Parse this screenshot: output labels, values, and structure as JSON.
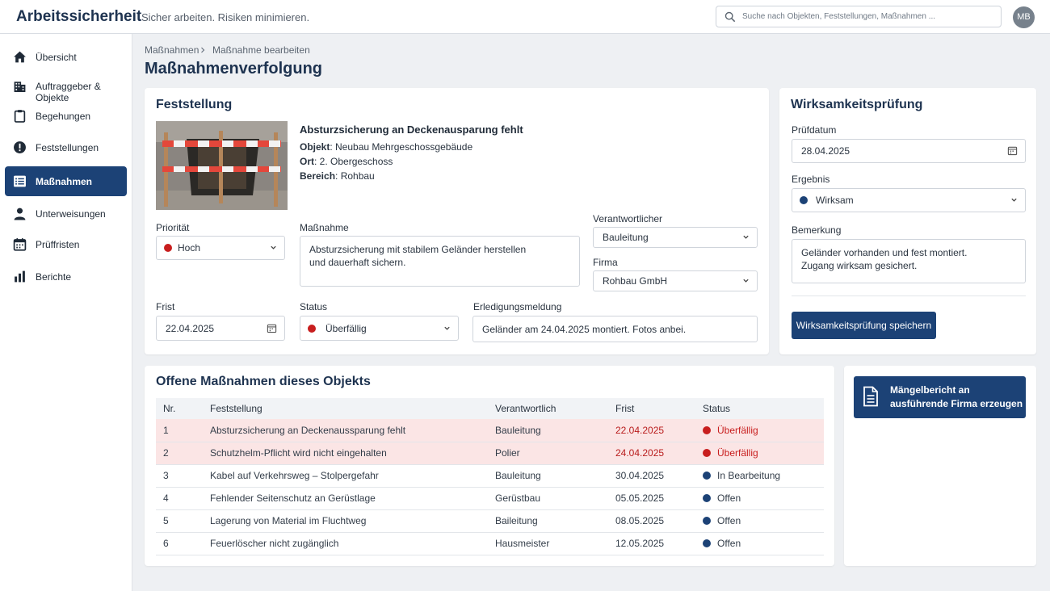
{
  "header": {
    "brand": "Arbeitssicherheit",
    "tagline": "Sicher arbeiten. Risiken minimieren.",
    "search_placeholder": "Suche nach Objekten, Feststellungen, Maßnahmen ...",
    "avatar": "MB"
  },
  "sidebar": {
    "items": [
      {
        "label": "Übersicht",
        "icon": "home-icon"
      },
      {
        "label": "Auftraggeber & Objekte",
        "icon": "building-icon"
      },
      {
        "label": "Begehungen",
        "icon": "clipboard-icon"
      },
      {
        "label": "Feststellungen",
        "icon": "alert-icon"
      },
      {
        "label": "Maßnahmen",
        "icon": "list-icon",
        "active": true
      },
      {
        "label": "Unterweisungen",
        "icon": "person-icon"
      },
      {
        "label": "Prüffristen",
        "icon": "calendar-icon"
      },
      {
        "label": "Berichte",
        "icon": "bar-chart-icon"
      }
    ]
  },
  "breadcrumb": {
    "parent": "Maßnahmen",
    "current": "Maßnahme bearbeiten"
  },
  "page_title": "Maßnahmenverfolgung",
  "feststellung": {
    "title": "Feststellung",
    "heading": "Absturzsicherung an Deckenausparung fehlt",
    "objekt_label": "Objekt",
    "objekt": ": Neubau Mehrgeschossgebäude",
    "ort_label": "Ort",
    "ort": ": 2. Obergeschoss",
    "bereich_label": "Bereich",
    "bereich": ": Rohbau",
    "prioritaet_label": "Priorität",
    "prioritaet": "Hoch",
    "massnahme_label": "Maßnahme",
    "massnahme": "Absturzsicherung mit stabilem Geländer herstellen\nund dauerhaft sichern.",
    "verantwortlicher_label": "Verantwortlicher",
    "verantwortlicher": "Bauleitung",
    "firma_label": "Firma",
    "firma": "Rohbau GmbH",
    "frist_label": "Frist",
    "frist": "22.04.2025",
    "status_label": "Status",
    "status": "Überfällig",
    "erledigung_label": "Erledigungsmeldung",
    "erledigung": "Geländer am 24.04.2025 montiert. Fotos anbei."
  },
  "wirksamkeit": {
    "title": "Wirksamkeitsprüfung",
    "pruefdatum_label": "Prüfdatum",
    "pruefdatum": "28.04.2025",
    "ergebnis_label": "Ergebnis",
    "ergebnis": "Wirksam",
    "bemerkung_label": "Bemerkung",
    "bemerkung": "Geländer vorhanden und fest montiert.\nZugang wirksam gesichert.",
    "save_label": "Wirksamkeitsprüfung speichern"
  },
  "offene": {
    "title": "Offene Maßnahmen dieses Objekts",
    "columns": [
      "Nr.",
      "Feststellung",
      "Verantwortlich",
      "Frist",
      "Status"
    ],
    "rows": [
      {
        "nr": "1",
        "feststellung": "Absturzsicherung an Deckenaussparung fehlt",
        "verantwortlich": "Bauleitung",
        "frist": "22.04.2025",
        "status": "Überfällig",
        "overdue": true
      },
      {
        "nr": "2",
        "feststellung": "Schutzhelm-Pflicht wird nicht eingehalten",
        "verantwortlich": "Polier",
        "frist": "24.04.2025",
        "status": "Überfällig",
        "overdue": true
      },
      {
        "nr": "3",
        "feststellung": "Kabel auf Verkehrsweg – Stolpergefahr",
        "verantwortlich": "Bauleitung",
        "frist": "30.04.2025",
        "status": "In Bearbeitung",
        "overdue": false
      },
      {
        "nr": "4",
        "feststellung": "Fehlender Seitenschutz an Gerüstlage",
        "verantwortlich": "Gerüstbau",
        "frist": "05.05.2025",
        "status": "Offen",
        "overdue": false
      },
      {
        "nr": "5",
        "feststellung": "Lagerung von Material im Fluchtweg",
        "verantwortlich": "Baileitung",
        "frist": "08.05.2025",
        "status": "Offen",
        "overdue": false
      },
      {
        "nr": "6",
        "feststellung": "Feuerlöscher nicht zugänglich",
        "verantwortlich": "Hausmeister",
        "frist": "12.05.2025",
        "status": "Offen",
        "overdue": false
      }
    ]
  },
  "report_button": "Mängelbericht an\nausführende Firma erzeugen",
  "colors": {
    "primary": "#1c4276",
    "overdue": "#c81e1e",
    "ok": "#1c4276",
    "overdue_row": "#fbe5e5"
  }
}
